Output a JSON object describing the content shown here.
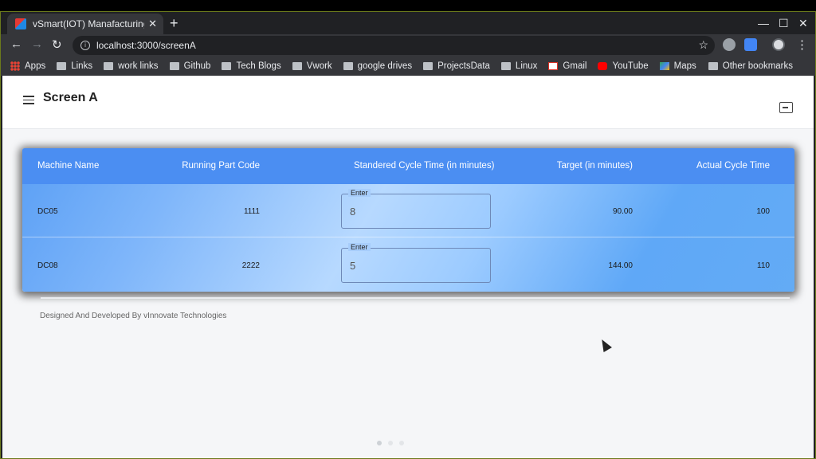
{
  "browser": {
    "tab_title": "vSmart(IOT) Manafacturing E",
    "url": "localhost:3000/screenA",
    "new_tab": "+",
    "tab_close": "✕",
    "back": "←",
    "forward": "→",
    "reload": "↻",
    "minimize": "—",
    "maximize": "☐",
    "close": "✕",
    "menu": "⋮",
    "star": "☆"
  },
  "bookmarks": [
    {
      "label": "Apps",
      "icon": "apps-icon"
    },
    {
      "label": "Links",
      "icon": "folder-icon"
    },
    {
      "label": "work links",
      "icon": "folder-icon"
    },
    {
      "label": "Github",
      "icon": "folder-icon"
    },
    {
      "label": "Tech Blogs",
      "icon": "folder-icon"
    },
    {
      "label": "Vwork",
      "icon": "folder-icon"
    },
    {
      "label": "google drives",
      "icon": "folder-icon"
    },
    {
      "label": "ProjectsData",
      "icon": "folder-icon"
    },
    {
      "label": "Linux",
      "icon": "folder-icon"
    },
    {
      "label": "Gmail",
      "icon": "gmail-icon"
    },
    {
      "label": "YouTube",
      "icon": "youtube-icon"
    },
    {
      "label": "Maps",
      "icon": "maps-icon"
    }
  ],
  "other_bookmarks": "Other bookmarks",
  "app": {
    "title": "Screen A",
    "footer": "Designed And Developed By vInnovate Technologies"
  },
  "table": {
    "headers": [
      "Machine Name",
      "Running Part Code",
      "Standered Cycle Time (in minutes)",
      "Target (in minutes)",
      "Actual Cycle Time"
    ],
    "rows": [
      {
        "machine": "DC05",
        "part_code": "1111",
        "field_label": "Enter",
        "std_cycle": "8",
        "target": "90.00",
        "actual": "100"
      },
      {
        "machine": "DC08",
        "part_code": "2222",
        "field_label": "Enter",
        "std_cycle": "5",
        "target": "144.00",
        "actual": "110"
      }
    ]
  },
  "colors": {
    "header": "#4b8ef2",
    "accent": "#5a9ff5"
  }
}
